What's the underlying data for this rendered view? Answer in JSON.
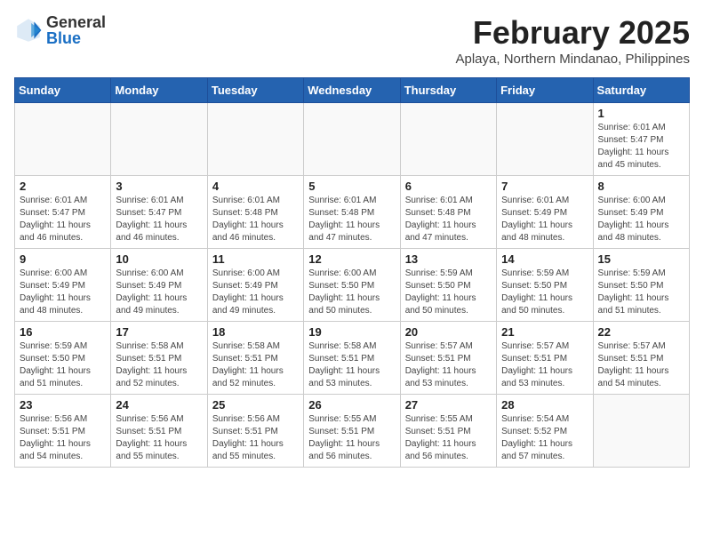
{
  "header": {
    "logo_general": "General",
    "logo_blue": "Blue",
    "month_title": "February 2025",
    "location": "Aplaya, Northern Mindanao, Philippines"
  },
  "days_of_week": [
    "Sunday",
    "Monday",
    "Tuesday",
    "Wednesday",
    "Thursday",
    "Friday",
    "Saturday"
  ],
  "weeks": [
    [
      {
        "day": "",
        "info": ""
      },
      {
        "day": "",
        "info": ""
      },
      {
        "day": "",
        "info": ""
      },
      {
        "day": "",
        "info": ""
      },
      {
        "day": "",
        "info": ""
      },
      {
        "day": "",
        "info": ""
      },
      {
        "day": "1",
        "info": "Sunrise: 6:01 AM\nSunset: 5:47 PM\nDaylight: 11 hours and 45 minutes."
      }
    ],
    [
      {
        "day": "2",
        "info": "Sunrise: 6:01 AM\nSunset: 5:47 PM\nDaylight: 11 hours and 46 minutes."
      },
      {
        "day": "3",
        "info": "Sunrise: 6:01 AM\nSunset: 5:47 PM\nDaylight: 11 hours and 46 minutes."
      },
      {
        "day": "4",
        "info": "Sunrise: 6:01 AM\nSunset: 5:48 PM\nDaylight: 11 hours and 46 minutes."
      },
      {
        "day": "5",
        "info": "Sunrise: 6:01 AM\nSunset: 5:48 PM\nDaylight: 11 hours and 47 minutes."
      },
      {
        "day": "6",
        "info": "Sunrise: 6:01 AM\nSunset: 5:48 PM\nDaylight: 11 hours and 47 minutes."
      },
      {
        "day": "7",
        "info": "Sunrise: 6:01 AM\nSunset: 5:49 PM\nDaylight: 11 hours and 48 minutes."
      },
      {
        "day": "8",
        "info": "Sunrise: 6:00 AM\nSunset: 5:49 PM\nDaylight: 11 hours and 48 minutes."
      }
    ],
    [
      {
        "day": "9",
        "info": "Sunrise: 6:00 AM\nSunset: 5:49 PM\nDaylight: 11 hours and 48 minutes."
      },
      {
        "day": "10",
        "info": "Sunrise: 6:00 AM\nSunset: 5:49 PM\nDaylight: 11 hours and 49 minutes."
      },
      {
        "day": "11",
        "info": "Sunrise: 6:00 AM\nSunset: 5:49 PM\nDaylight: 11 hours and 49 minutes."
      },
      {
        "day": "12",
        "info": "Sunrise: 6:00 AM\nSunset: 5:50 PM\nDaylight: 11 hours and 50 minutes."
      },
      {
        "day": "13",
        "info": "Sunrise: 5:59 AM\nSunset: 5:50 PM\nDaylight: 11 hours and 50 minutes."
      },
      {
        "day": "14",
        "info": "Sunrise: 5:59 AM\nSunset: 5:50 PM\nDaylight: 11 hours and 50 minutes."
      },
      {
        "day": "15",
        "info": "Sunrise: 5:59 AM\nSunset: 5:50 PM\nDaylight: 11 hours and 51 minutes."
      }
    ],
    [
      {
        "day": "16",
        "info": "Sunrise: 5:59 AM\nSunset: 5:50 PM\nDaylight: 11 hours and 51 minutes."
      },
      {
        "day": "17",
        "info": "Sunrise: 5:58 AM\nSunset: 5:51 PM\nDaylight: 11 hours and 52 minutes."
      },
      {
        "day": "18",
        "info": "Sunrise: 5:58 AM\nSunset: 5:51 PM\nDaylight: 11 hours and 52 minutes."
      },
      {
        "day": "19",
        "info": "Sunrise: 5:58 AM\nSunset: 5:51 PM\nDaylight: 11 hours and 53 minutes."
      },
      {
        "day": "20",
        "info": "Sunrise: 5:57 AM\nSunset: 5:51 PM\nDaylight: 11 hours and 53 minutes."
      },
      {
        "day": "21",
        "info": "Sunrise: 5:57 AM\nSunset: 5:51 PM\nDaylight: 11 hours and 53 minutes."
      },
      {
        "day": "22",
        "info": "Sunrise: 5:57 AM\nSunset: 5:51 PM\nDaylight: 11 hours and 54 minutes."
      }
    ],
    [
      {
        "day": "23",
        "info": "Sunrise: 5:56 AM\nSunset: 5:51 PM\nDaylight: 11 hours and 54 minutes."
      },
      {
        "day": "24",
        "info": "Sunrise: 5:56 AM\nSunset: 5:51 PM\nDaylight: 11 hours and 55 minutes."
      },
      {
        "day": "25",
        "info": "Sunrise: 5:56 AM\nSunset: 5:51 PM\nDaylight: 11 hours and 55 minutes."
      },
      {
        "day": "26",
        "info": "Sunrise: 5:55 AM\nSunset: 5:51 PM\nDaylight: 11 hours and 56 minutes."
      },
      {
        "day": "27",
        "info": "Sunrise: 5:55 AM\nSunset: 5:51 PM\nDaylight: 11 hours and 56 minutes."
      },
      {
        "day": "28",
        "info": "Sunrise: 5:54 AM\nSunset: 5:52 PM\nDaylight: 11 hours and 57 minutes."
      },
      {
        "day": "",
        "info": ""
      }
    ]
  ]
}
